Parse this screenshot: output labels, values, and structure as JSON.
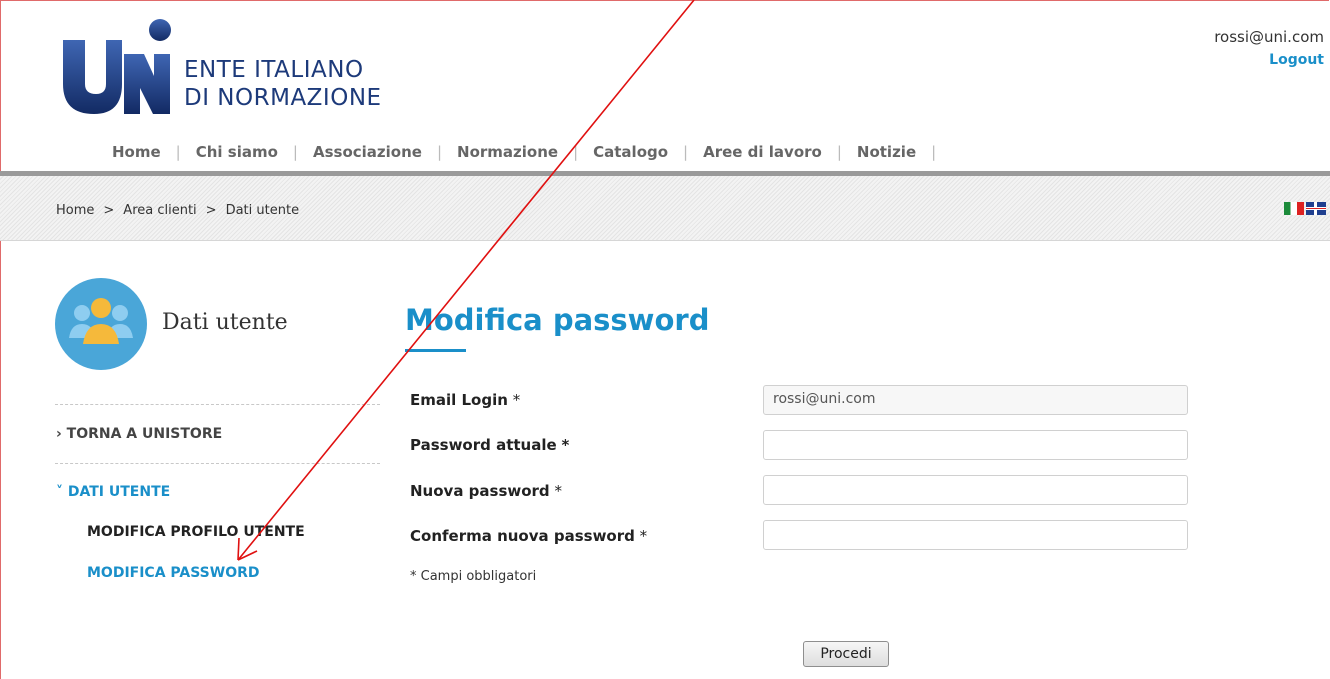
{
  "header": {
    "brand_line1": "ENTE ITALIANO",
    "brand_line2": "DI NORMAZIONE",
    "user_email": "rossi@uni.com",
    "logout_label": "Logout"
  },
  "nav": [
    "Home",
    "Chi siamo",
    "Associazione",
    "Normazione",
    "Catalogo",
    "Aree di lavoro",
    "Notizie"
  ],
  "breadcrumb": [
    "Home",
    "Area clienti",
    "Dati utente"
  ],
  "sidebar": {
    "title": "Dati utente",
    "back_link": "› TORNA A UNISTORE",
    "section_label": "˅ DATI UTENTE",
    "items": [
      {
        "label": "MODIFICA PROFILO UTENTE",
        "active": false
      },
      {
        "label": "MODIFICA PASSWORD",
        "active": true
      }
    ]
  },
  "form": {
    "title": "Modifica password",
    "fields": [
      {
        "label": "Email Login",
        "value": "rossi@uni.com"
      },
      {
        "label": "Password attuale",
        "value": ""
      },
      {
        "label": "Nuova password",
        "value": ""
      },
      {
        "label": "Conferma nuova password",
        "value": ""
      }
    ],
    "required_mark": "*",
    "required_note": "* Campi obbligatori",
    "submit_label": "Procedi"
  },
  "colors": {
    "accent": "#1a8fc9",
    "brand_navy": "#1d3a7a",
    "annotation_arrow": "#e01010"
  },
  "icons": [
    "uni-logo",
    "users-icon",
    "flag-it-icon",
    "flag-uk-icon",
    "annotation-arrow"
  ]
}
